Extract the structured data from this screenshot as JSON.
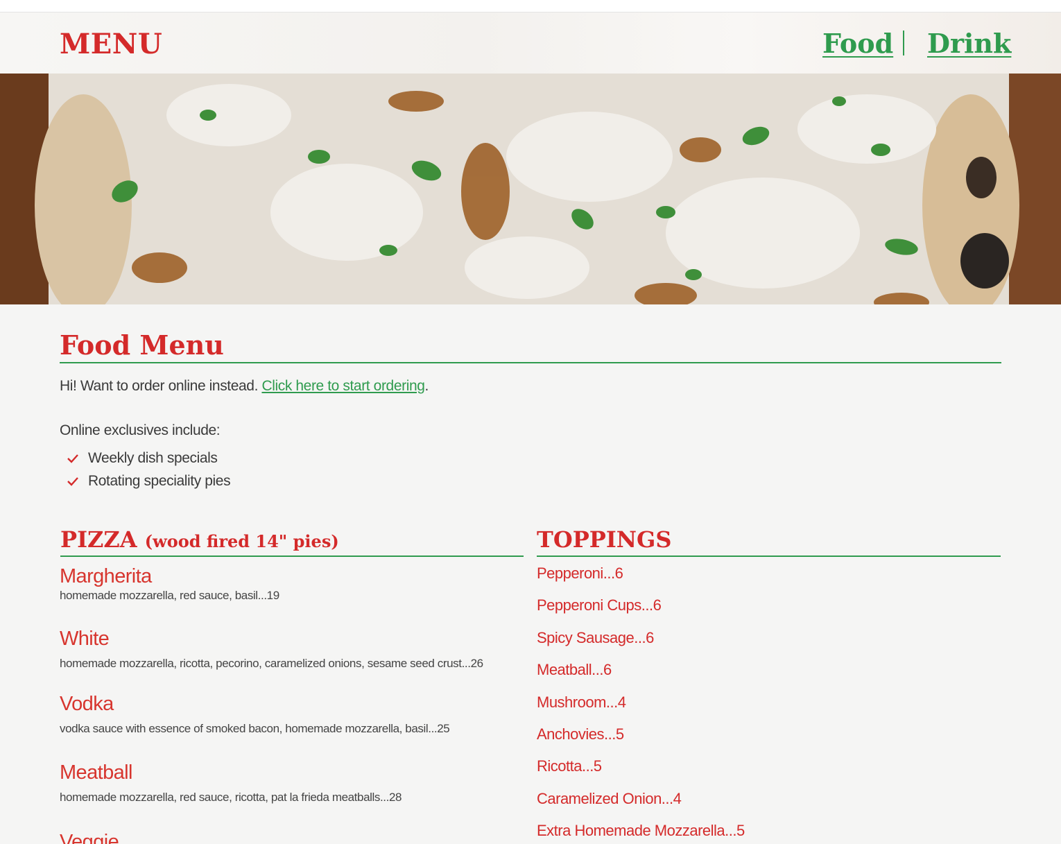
{
  "header": {
    "title": "MENU",
    "nav": {
      "food": "Food",
      "drink": "Drink"
    }
  },
  "main": {
    "heading": "Food Menu",
    "intro_text": "Hi! Want to order online instead.",
    "intro_link": "Click here to start ordering",
    "intro_end": ".",
    "exclusives_title": "Online exclusives include:",
    "exclusives": [
      "Weekly dish specials",
      "Rotating speciality pies"
    ]
  },
  "pizza": {
    "title": "PIZZA",
    "subtitle": "(wood fired 14\" pies)",
    "items": [
      {
        "name": "Margherita",
        "desc": "homemade mozzarella, red sauce, basil...19"
      },
      {
        "name": "White",
        "desc": "homemade mozzarella, ricotta, pecorino, caramelized onions, sesame seed crust...26"
      },
      {
        "name": "Vodka",
        "desc": "vodka sauce with essence of smoked bacon, homemade mozzarella, basil...25"
      },
      {
        "name": "Meatball",
        "desc": "homemade mozzarella, red sauce, ricotta, pat la frieda meatballs...28"
      },
      {
        "name": "Veggie",
        "desc": ""
      }
    ]
  },
  "toppings": {
    "title": "TOPPINGS",
    "items": [
      "Pepperoni...6",
      "Pepperoni Cups...6",
      "Spicy Sausage...6",
      "Meatball...6",
      "Mushroom...4",
      "Anchovies...5",
      "Ricotta...5",
      "Caramelized Onion...4",
      "Extra Homemade Mozzarella...5"
    ]
  },
  "colors": {
    "accent_red": "#d42a2a",
    "accent_green": "#2f9b4e",
    "background": "#f5f5f4"
  },
  "icons": {
    "check": "check-icon"
  }
}
